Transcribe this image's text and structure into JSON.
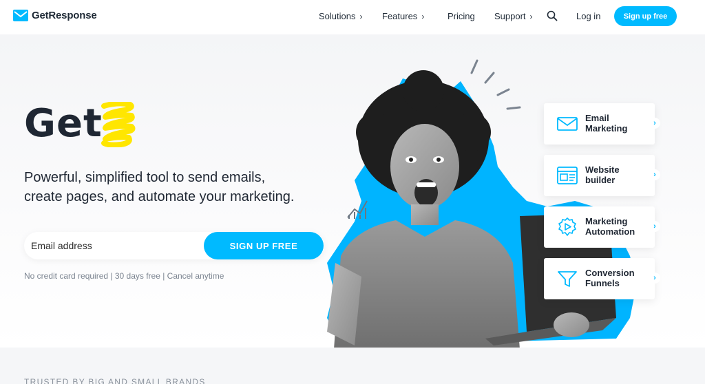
{
  "brand": {
    "name": "GetResponse",
    "accent": "#00baff",
    "highlight": "#ffe600"
  },
  "nav": {
    "items": [
      {
        "label": "Solutions",
        "has_chevron": true
      },
      {
        "label": "Features",
        "has_chevron": true
      },
      {
        "label": "Pricing",
        "has_chevron": false
      },
      {
        "label": "Support",
        "has_chevron": true
      }
    ],
    "search_icon": "search-icon",
    "login_label": "Log in",
    "signup_label": "Sign up free"
  },
  "hero": {
    "title": "Get",
    "subtitle_line1": "Powerful, simplified tool to send emails,",
    "subtitle_line2": "create pages, and automate your marketing.",
    "email_placeholder": "Email address",
    "signup_label": "SIGN UP FREE",
    "fine_print": "No credit card required | 30 days free | Cancel anytime"
  },
  "features": [
    {
      "line1": "Email",
      "line2": "Marketing",
      "icon": "envelope-icon"
    },
    {
      "line1": "Website",
      "line2": "builder",
      "icon": "browser-icon"
    },
    {
      "line1": "Marketing",
      "line2": "Automation",
      "icon": "gear-play-icon"
    },
    {
      "line1": "Conversion",
      "line2": "Funnels",
      "icon": "funnel-icon"
    }
  ],
  "trusted_label": "TRUSTED BY BIG AND SMALL BRANDS"
}
